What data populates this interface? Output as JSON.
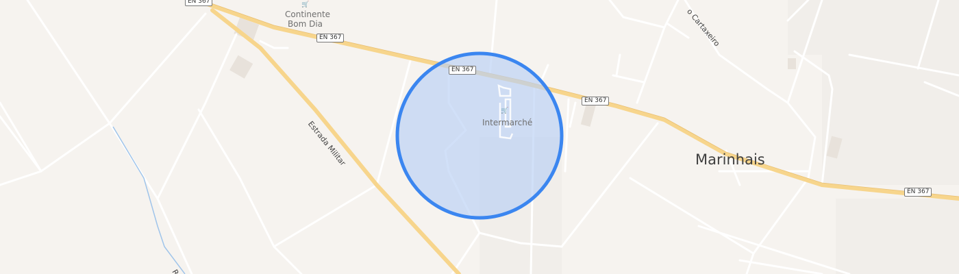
{
  "map": {
    "town_label": "Marinhais",
    "poi": [
      {
        "name": "Continente",
        "name2": "Bom Dia",
        "icon": "shopping-cart-icon"
      },
      {
        "name": "Intermarché",
        "icon": "shopping-cart-icon"
      }
    ],
    "road_shields": [
      "EN 367",
      "EN 367",
      "EN 367",
      "EN 367",
      "EN 367"
    ],
    "streets": {
      "estrada_militar": "Estrada Militar",
      "cartaxeiro": "o Cartaxeiro",
      "bottom_left": "R"
    },
    "colors": {
      "background": "#f6f3ef",
      "main_road": "#f7d58c",
      "minor_road": "#ffffff",
      "circle_fill": "#b9d0f4",
      "circle_stroke": "#3b86f0",
      "water": "#9fc4ea"
    }
  }
}
